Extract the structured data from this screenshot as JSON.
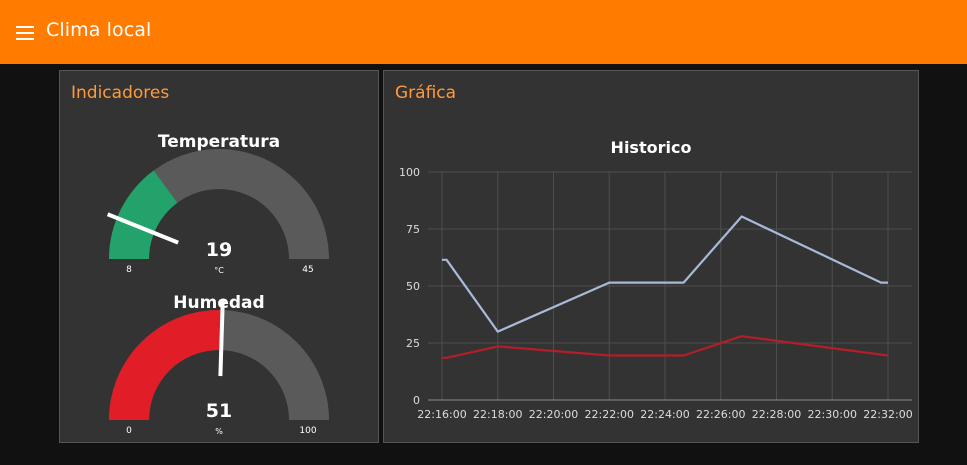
{
  "app": {
    "title": "Clima local",
    "menu_icon": "hamburger-menu-icon",
    "accent_color": "#ff7c00"
  },
  "indicadores": {
    "title": "Indicadores",
    "gauges": [
      {
        "title": "Temperatura",
        "value": 19,
        "value_text": "19",
        "unit": "°C",
        "min": 8,
        "min_text": "8",
        "max": 45,
        "max_text": "45",
        "color": "#23a26b",
        "needle_value": 12.5
      },
      {
        "title": "Humedad",
        "value": 51,
        "value_text": "51",
        "unit": "%",
        "min": 0,
        "min_text": "0",
        "max": 100,
        "max_text": "100",
        "color": "#e11d27",
        "needle_value": 51
      }
    ]
  },
  "grafica": {
    "title": "Gráfica",
    "chart_data": {
      "type": "line",
      "title": "Historico",
      "xlabel": "",
      "ylabel": "",
      "ylim": [
        0,
        100
      ],
      "yticks": [
        "0",
        "25",
        "50",
        "75",
        "100"
      ],
      "xlim": [
        "22:16:00",
        "22:32:00"
      ],
      "xticks": [
        "22:16:00",
        "22:18:00",
        "22:20:00",
        "22:22:00",
        "22:24:00",
        "22:26:00",
        "22:28:00",
        "22:30:00",
        "22:32:00"
      ],
      "grid": true,
      "legend": "none",
      "series": [
        {
          "color": "#a9b9d8",
          "x": [
            "22:16:00",
            "22:16:10",
            "22:18:00",
            "22:22:00",
            "22:24:40",
            "22:26:45",
            "22:31:45",
            "22:32:00"
          ],
          "values": [
            61.5,
            61.5,
            30,
            51.5,
            51.5,
            80.5,
            51.5,
            51.5
          ]
        },
        {
          "color": "#b31e28",
          "x": [
            "22:16:00",
            "22:16:10",
            "22:18:00",
            "22:22:00",
            "22:24:40",
            "22:26:45",
            "22:32:00"
          ],
          "values": [
            18.5,
            18.5,
            23.5,
            19.5,
            19.5,
            28,
            19.5
          ]
        }
      ]
    }
  }
}
